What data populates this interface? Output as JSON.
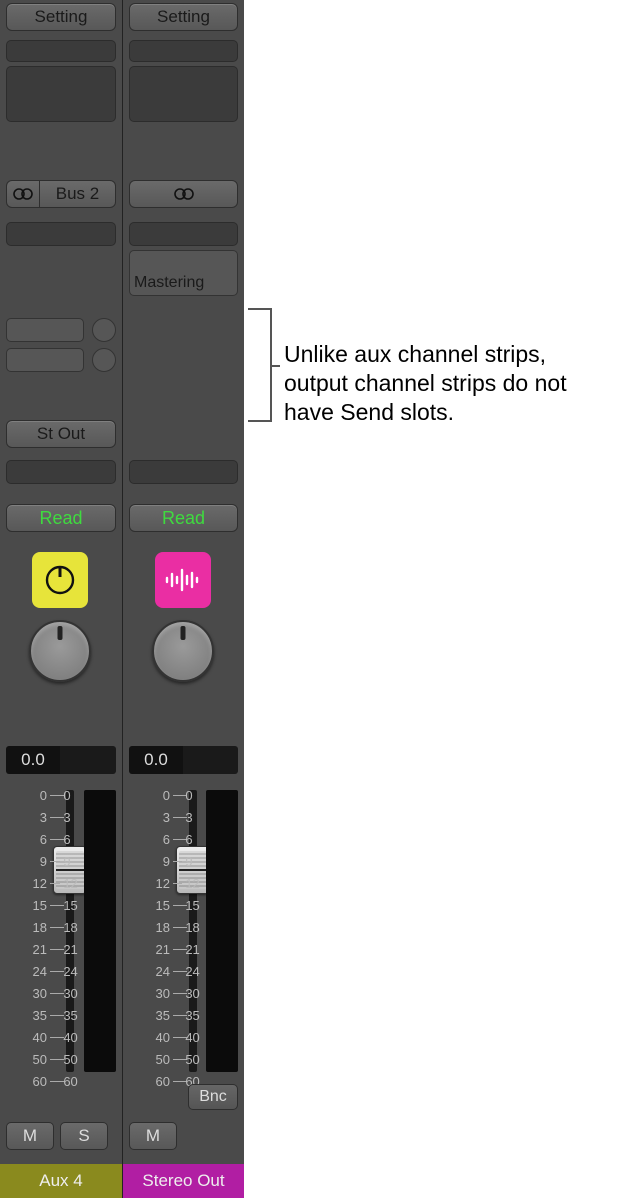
{
  "channels": [
    {
      "kind": "aux",
      "setting_label": "Setting",
      "input_label": "Bus 2",
      "output_label": "St Out",
      "automation_label": "Read",
      "volume_display": "0.0",
      "mute_label": "M",
      "solo_label": "S",
      "name": "Aux 4",
      "strip_color": "#8a8a1e",
      "icon": {
        "semantic": "knob-icon",
        "bg": "#e7e43a"
      }
    },
    {
      "kind": "output",
      "setting_label": "Setting",
      "mastering_label": "Mastering",
      "automation_label": "Read",
      "volume_display": "0.0",
      "mute_label": "M",
      "bnc_label": "Bnc",
      "name": "Stereo Out",
      "strip_color": "#b11ea3",
      "icon": {
        "semantic": "waveform-icon",
        "bg": "#ea2ea3"
      }
    }
  ],
  "fader_scale": [
    "0",
    "3",
    "6",
    "9",
    "12",
    "15",
    "18",
    "21",
    "24",
    "30",
    "35",
    "40",
    "50",
    "60"
  ],
  "annotation": "Unlike aux channel strips, output channel strips do not have Send slots."
}
